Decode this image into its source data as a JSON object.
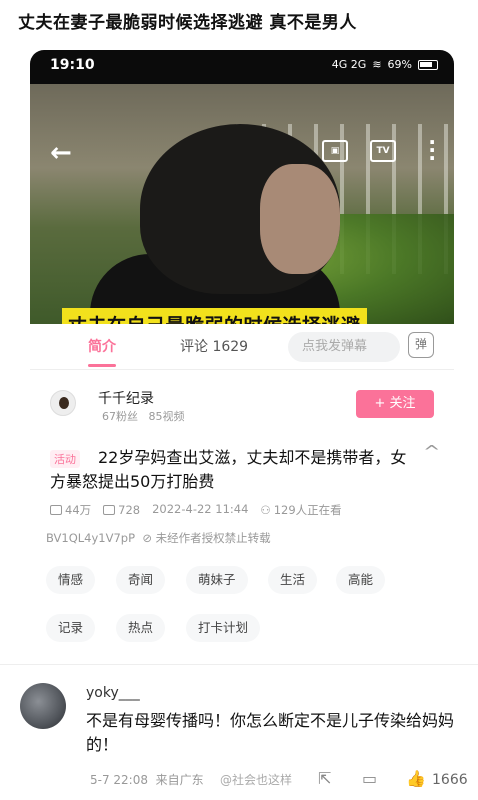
{
  "post": {
    "title": "丈夫在妻子最脆弱时候选择逃避 真不是男人"
  },
  "statusbar": {
    "time": "19:10",
    "network": "4G 2G",
    "battery": "69%"
  },
  "video": {
    "subtitle": "丈夫在自己最脆弱的时候选择逃避"
  },
  "tabs": [
    {
      "label": "简介"
    },
    {
      "label": "评论 1629"
    }
  ],
  "danmu": {
    "placeholder": "点我发弹幕",
    "toggle": "弹"
  },
  "uploader": {
    "name": "千千纪录",
    "fans": "67粉丝",
    "videos": "85视频",
    "follow_label": "+ 关注"
  },
  "video_info": {
    "badge": "活动",
    "title": "22岁孕妈查出艾滋，丈夫却不是携带者，女方暴怒提出50万打胎费",
    "views": "44万",
    "danmaku": "728",
    "date": "2022-4-22 11:44",
    "watching": "129人正在看",
    "bvid": "BV1QL4y1V7pP",
    "copyright": "未经作者授权禁止转载"
  },
  "tags": [
    "情感",
    "奇闻",
    "萌妹子",
    "生活",
    "高能",
    "记录",
    "热点",
    "打卡计划"
  ],
  "comment": {
    "user": "yoky___",
    "text": "不是有母婴传播吗！你怎么断定不是儿子传染给妈妈的！",
    "time": "5-7 22:08",
    "location": "来自广东",
    "watermark": "@社会也这样",
    "likes": "1666"
  }
}
